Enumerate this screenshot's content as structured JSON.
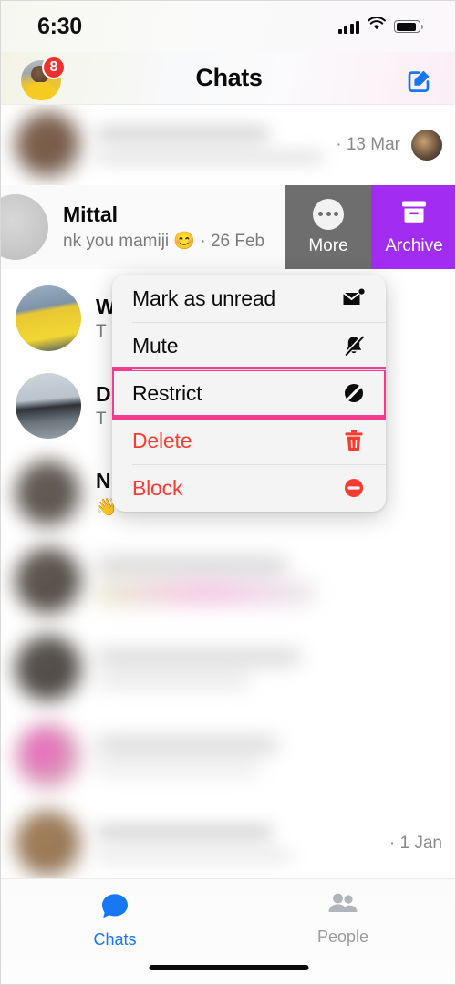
{
  "status_bar": {
    "time": "6:30",
    "signal_icon": "cellular-signal-icon",
    "wifi_icon": "wifi-icon",
    "battery_icon": "battery-icon"
  },
  "header": {
    "title": "Chats",
    "avatar_name": "profile-avatar",
    "unread_badge": "8",
    "compose_icon": "compose-icon",
    "compose_color": "#1877f2"
  },
  "chat_list": {
    "rows": [
      {
        "name": "",
        "preview": "",
        "time": "· 13 Mar",
        "blurred": true,
        "has_thumb": true
      },
      {
        "name": "Mittal",
        "preview": "nk you mamiji 😊 · 26 Feb",
        "time": "",
        "blurred": false,
        "read_receipt": "read-check-icon",
        "swiped": true
      },
      {
        "name": "W",
        "preview": "T",
        "time": "",
        "blurred": false,
        "avatar_desc": "man-in-yellow-tank-top"
      },
      {
        "name": "D",
        "preview": "T",
        "time": "",
        "blurred": false,
        "avatar_desc": "man-standing-by-car"
      },
      {
        "name": "N",
        "preview": "👋",
        "time": "",
        "blurred": false,
        "avatar_desc": "blurred-portrait"
      },
      {
        "name": "",
        "preview": "",
        "time": "",
        "blurred": true
      },
      {
        "name": "",
        "preview": "",
        "time": "",
        "blurred": true
      },
      {
        "name": "",
        "preview": "",
        "time": "",
        "blurred": true
      },
      {
        "name": "",
        "preview": "",
        "time": "· 1 Jan",
        "blurred": true
      },
      {
        "name": "",
        "preview": "",
        "time": "",
        "blurred": true
      }
    ]
  },
  "swipe_actions": {
    "more": {
      "label": "More",
      "icon": "more-dots-icon",
      "color": "#6e6e6e"
    },
    "archive": {
      "label": "Archive",
      "icon": "archive-box-icon",
      "color": "#a32cf2"
    }
  },
  "context_menu": {
    "highlight_color": "#f73b8c",
    "items": [
      {
        "label": "Mark as unread",
        "icon": "mail-unread-icon",
        "danger": false,
        "highlighted": false
      },
      {
        "label": "Mute",
        "icon": "bell-slash-icon",
        "danger": false,
        "highlighted": false
      },
      {
        "label": "Restrict",
        "icon": "restrict-slash-icon",
        "danger": false,
        "highlighted": true
      },
      {
        "label": "Delete",
        "icon": "trash-icon",
        "danger": true,
        "highlighted": false
      },
      {
        "label": "Block",
        "icon": "block-icon",
        "danger": true,
        "highlighted": false
      }
    ]
  },
  "tab_bar": {
    "tabs": [
      {
        "label": "Chats",
        "icon": "chat-bubble-icon",
        "active": true,
        "color": "#1877f2"
      },
      {
        "label": "People",
        "icon": "people-icon",
        "active": false,
        "color": "#9b9b9b"
      }
    ]
  }
}
